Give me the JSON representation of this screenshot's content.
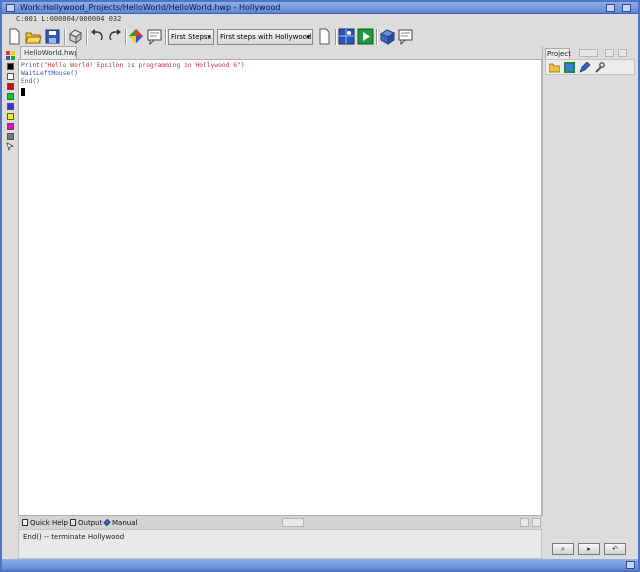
{
  "window": {
    "title": "Work:Hollywood_Projects/HelloWorld/HelloWorld.hwp - Hollywood"
  },
  "status": {
    "text": "C:001  L:000004/000004  032"
  },
  "toolbar": {
    "popup_first_steps": "First Steps...",
    "popup_first_steps_hollywood": "First steps with Hollywood...",
    "popup_arrow": "▾"
  },
  "document": {
    "tab_label": "HelloWorld.hwp"
  },
  "palette": {
    "colors": [
      "#000000",
      "#ffffff",
      "#e00000",
      "#00cc33",
      "#3333dd",
      "#ffee00",
      "#ee00cc",
      "#777777"
    ]
  },
  "editor": {
    "lines": [
      {
        "fn": "Print(",
        "str": "\"Hello World! Epsilon is programming in Hollywood 6\"",
        "end": ")"
      },
      {
        "fn": "WaitLeftMouse()",
        "str": "",
        "end": ""
      },
      {
        "fn": "End()",
        "str": "",
        "end": ""
      }
    ]
  },
  "project": {
    "tab_label": "Project"
  },
  "bottom": {
    "tabs": [
      "Quick Help",
      "Output",
      "Manual"
    ],
    "help_text": "End() -- terminate Hollywood"
  },
  "colors": {
    "title_bar": "#6f95dc",
    "function_text": "#3650b8",
    "string_text": "#d43030"
  }
}
